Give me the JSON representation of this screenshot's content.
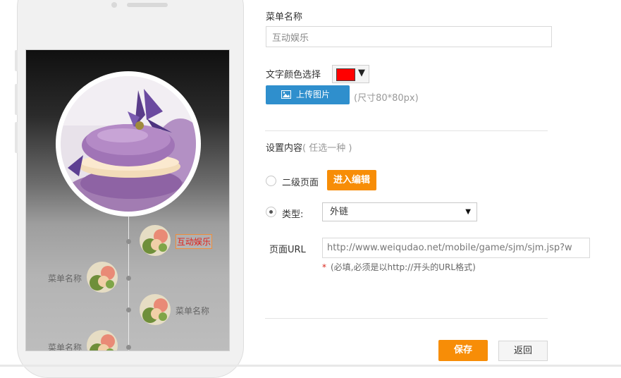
{
  "form": {
    "menu_name_label": "菜单名称",
    "menu_name_value": "互动娱乐",
    "text_color_label": "文字颜色选择",
    "text_color_value": "#ff0000",
    "upload_button": "上传图片",
    "upload_hint": "(尺寸80*80px)",
    "content_label": "设置内容",
    "content_hint": "( 任选一种 )",
    "option_subpage_label": "二级页面",
    "edit_button": "进入编辑",
    "option_type_label": "类型:",
    "type_selected": "外链",
    "url_label": "页面URL",
    "url_value": "http://www.weiqudao.net/mobile/game/sjm/sjm.jsp?w",
    "url_required_hint": "(必填,必须是以http://开头的URL格式)",
    "required_star": "*",
    "save_button": "保存",
    "back_button": "返回"
  },
  "preview": {
    "menu_items": [
      {
        "label": "互动娱乐",
        "active": true,
        "side": "right"
      },
      {
        "label": "菜单名称",
        "active": false,
        "side": "left"
      },
      {
        "label": "菜单名称",
        "active": false,
        "side": "right"
      },
      {
        "label": "菜单名称",
        "active": false,
        "side": "left"
      }
    ]
  },
  "colors": {
    "accent_orange": "#f78d07",
    "upload_blue": "#2f8fcd",
    "active_label_red": "#e0201b"
  }
}
